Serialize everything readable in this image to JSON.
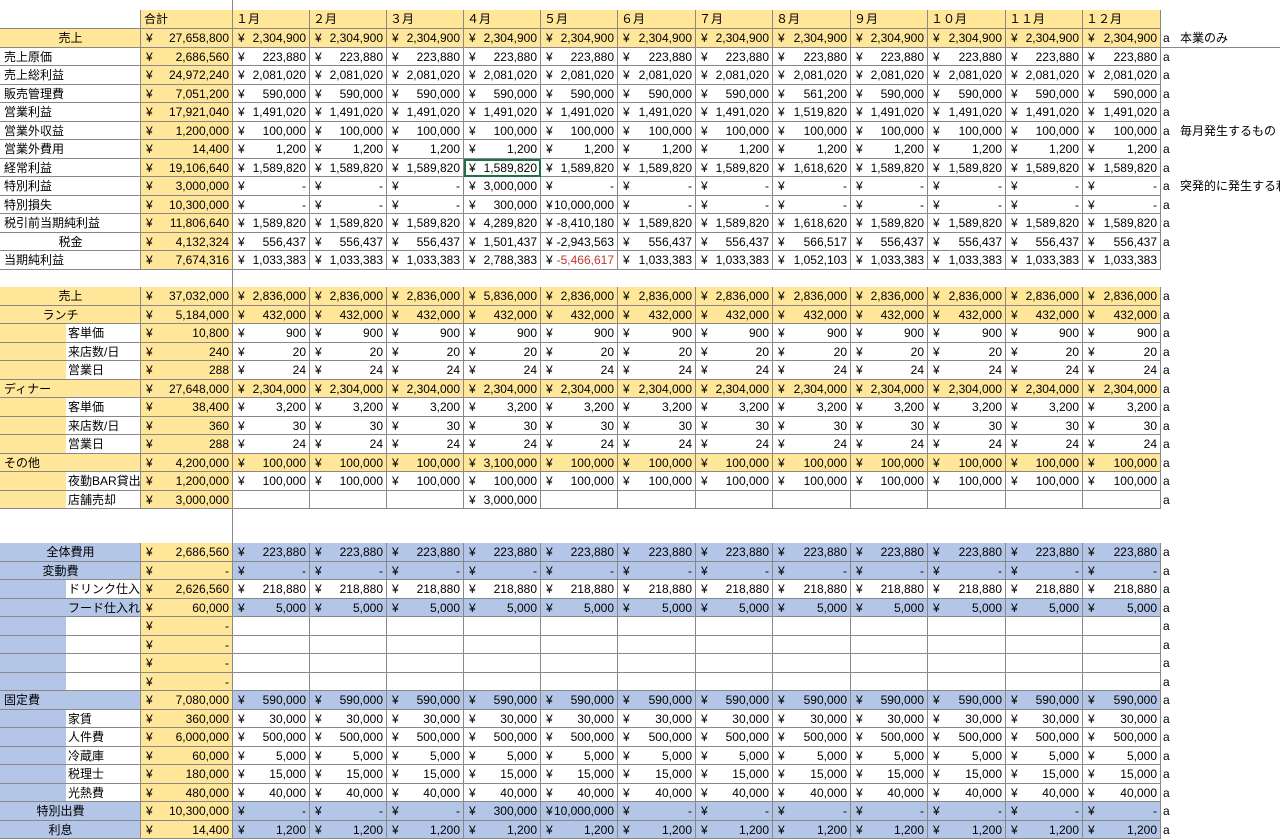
{
  "header": {
    "total_label": "合計",
    "months": [
      "１月",
      "２月",
      "３月",
      "４月",
      "５月",
      "６月",
      "７月",
      "８月",
      "９月",
      "１０月",
      "１１月",
      "１２月"
    ]
  },
  "colors": {
    "yellow": "#ffe699",
    "blue": "#b4c6e7",
    "selection": "#1e7145",
    "negative": "#c0392b"
  },
  "sections": [
    {
      "id": "pl",
      "rows": [
        {
          "label": "売上",
          "indent": "center",
          "fill": "yellow",
          "total": "27,658,800",
          "months": [
            "2,304,900",
            "2,304,900",
            "2,304,900",
            "2,304,900",
            "2,304,900",
            "2,304,900",
            "2,304,900",
            "2,304,900",
            "2,304,900",
            "2,304,900",
            "2,304,900",
            "2,304,900"
          ],
          "suffix": "a",
          "note": "本業のみ"
        },
        {
          "label": "売上原価",
          "indent": "none",
          "fill": "none",
          "total": "2,686,560",
          "months": [
            "223,880",
            "223,880",
            "223,880",
            "223,880",
            "223,880",
            "223,880",
            "223,880",
            "223,880",
            "223,880",
            "223,880",
            "223,880",
            "223,880"
          ],
          "suffix": "a"
        },
        {
          "label": "売上総利益",
          "indent": "none",
          "fill": "none",
          "total": "24,972,240",
          "months": [
            "2,081,020",
            "2,081,020",
            "2,081,020",
            "2,081,020",
            "2,081,020",
            "2,081,020",
            "2,081,020",
            "2,081,020",
            "2,081,020",
            "2,081,020",
            "2,081,020",
            "2,081,020"
          ],
          "suffix": "a"
        },
        {
          "label": "販売管理費",
          "indent": "none",
          "fill": "none",
          "total": "7,051,200",
          "months": [
            "590,000",
            "590,000",
            "590,000",
            "590,000",
            "590,000",
            "590,000",
            "590,000",
            "561,200",
            "590,000",
            "590,000",
            "590,000",
            "590,000"
          ],
          "suffix": "a",
          "flags": true
        },
        {
          "label": "営業利益",
          "indent": "none",
          "fill": "none",
          "total": "17,921,040",
          "months": [
            "1,491,020",
            "1,491,020",
            "1,491,020",
            "1,491,020",
            "1,491,020",
            "1,491,020",
            "1,491,020",
            "1,519,820",
            "1,491,020",
            "1,491,020",
            "1,491,020",
            "1,491,020"
          ],
          "suffix": "a"
        },
        {
          "label": "営業外収益",
          "indent": "none",
          "fill": "none",
          "total": "1,200,000",
          "months": [
            "100,000",
            "100,000",
            "100,000",
            "100,000",
            "100,000",
            "100,000",
            "100,000",
            "100,000",
            "100,000",
            "100,000",
            "100,000",
            "100,000"
          ],
          "suffix": "a",
          "note": "毎月発生するもの"
        },
        {
          "label": "営業外費用",
          "indent": "none",
          "fill": "none",
          "total": "14,400",
          "months": [
            "1,200",
            "1,200",
            "1,200",
            "1,200",
            "1,200",
            "1,200",
            "1,200",
            "1,200",
            "1,200",
            "1,200",
            "1,200",
            "1,200"
          ],
          "suffix": "a"
        },
        {
          "label": "経常利益",
          "indent": "none",
          "fill": "none",
          "total": "19,106,640",
          "months": [
            "1,589,820",
            "1,589,820",
            "1,589,820",
            "1,589,820",
            "1,589,820",
            "1,589,820",
            "1,589,820",
            "1,618,620",
            "1,589,820",
            "1,589,820",
            "1,589,820",
            "1,589,820"
          ],
          "suffix": "a",
          "selected": 4
        },
        {
          "label": "特別利益",
          "indent": "none",
          "fill": "none",
          "total": "3,000,000",
          "months": [
            "-",
            "-",
            "-",
            "3,000,000",
            "-",
            "-",
            "-",
            "-",
            "-",
            "-",
            "-",
            "-"
          ],
          "suffix": "a",
          "note": "突発的に発生する利"
        },
        {
          "label": "特別損失",
          "indent": "none",
          "fill": "none",
          "total": "10,300,000",
          "months": [
            "-",
            "-",
            "-",
            "300,000",
            "10,000,000",
            "-",
            "-",
            "-",
            "-",
            "-",
            "-",
            "-"
          ],
          "suffix": "a"
        },
        {
          "label": "税引前当期純利益",
          "indent": "none",
          "fill": "none",
          "total": "11,806,640",
          "months": [
            "1,589,820",
            "1,589,820",
            "1,589,820",
            "4,289,820",
            "-8,410,180",
            "1,589,820",
            "1,589,820",
            "1,618,620",
            "1,589,820",
            "1,589,820",
            "1,589,820",
            "1,589,820"
          ],
          "suffix": "a"
        },
        {
          "label": "税金",
          "indent": "center",
          "fill": "none",
          "total": "4,132,324",
          "months": [
            "556,437",
            "556,437",
            "556,437",
            "1,501,437",
            "-2,943,563",
            "556,437",
            "556,437",
            "566,517",
            "556,437",
            "556,437",
            "556,437",
            "556,437"
          ],
          "suffix": "a"
        },
        {
          "label": "当期純利益",
          "indent": "none",
          "fill": "none",
          "total": "7,674,316",
          "months": [
            "1,033,383",
            "1,033,383",
            "1,033,383",
            "2,788,383",
            "-5,466,617",
            "1,033,383",
            "1,033,383",
            "1,052,103",
            "1,033,383",
            "1,033,383",
            "1,033,383",
            "1,033,383"
          ],
          "suffix": "",
          "negative_month": 5
        }
      ]
    },
    {
      "id": "sales",
      "rows": [
        {
          "label": "売上",
          "indent": "center",
          "fill": "yellow",
          "total": "37,032,000",
          "months": [
            "2,836,000",
            "2,836,000",
            "2,836,000",
            "5,836,000",
            "2,836,000",
            "2,836,000",
            "2,836,000",
            "2,836,000",
            "2,836,000",
            "2,836,000",
            "2,836,000",
            "2,836,000"
          ],
          "suffix": "a"
        },
        {
          "label": "ランチ",
          "indent": "mid",
          "fill": "yellow",
          "total": "5,184,000",
          "months": [
            "432,000",
            "432,000",
            "432,000",
            "432,000",
            "432,000",
            "432,000",
            "432,000",
            "432,000",
            "432,000",
            "432,000",
            "432,000",
            "432,000"
          ],
          "suffix": "a"
        },
        {
          "label": "客単価",
          "indent": "sub",
          "fill": "white",
          "total": "10,800",
          "months": [
            "900",
            "900",
            "900",
            "900",
            "900",
            "900",
            "900",
            "900",
            "900",
            "900",
            "900",
            "900"
          ],
          "suffix": "a"
        },
        {
          "label": "来店数/日",
          "indent": "sub",
          "fill": "white",
          "total": "240",
          "months": [
            "20",
            "20",
            "20",
            "20",
            "20",
            "20",
            "20",
            "20",
            "20",
            "20",
            "20",
            "20"
          ],
          "suffix": "a"
        },
        {
          "label": "営業日",
          "indent": "sub",
          "fill": "white",
          "total": "288",
          "months": [
            "24",
            "24",
            "24",
            "24",
            "24",
            "24",
            "24",
            "24",
            "24",
            "24",
            "24",
            "24"
          ],
          "suffix": "a"
        },
        {
          "label": "ディナー",
          "indent": "none",
          "fill": "yellow",
          "total": "27,648,000",
          "months": [
            "2,304,000",
            "2,304,000",
            "2,304,000",
            "2,304,000",
            "2,304,000",
            "2,304,000",
            "2,304,000",
            "2,304,000",
            "2,304,000",
            "2,304,000",
            "2,304,000",
            "2,304,000"
          ],
          "suffix": "a"
        },
        {
          "label": "客単価",
          "indent": "sub",
          "fill": "white",
          "total": "38,400",
          "months": [
            "3,200",
            "3,200",
            "3,200",
            "3,200",
            "3,200",
            "3,200",
            "3,200",
            "3,200",
            "3,200",
            "3,200",
            "3,200",
            "3,200"
          ],
          "suffix": "a"
        },
        {
          "label": "来店数/日",
          "indent": "sub",
          "fill": "white",
          "total": "360",
          "months": [
            "30",
            "30",
            "30",
            "30",
            "30",
            "30",
            "30",
            "30",
            "30",
            "30",
            "30",
            "30"
          ],
          "suffix": "a"
        },
        {
          "label": "営業日",
          "indent": "sub",
          "fill": "white",
          "total": "288",
          "months": [
            "24",
            "24",
            "24",
            "24",
            "24",
            "24",
            "24",
            "24",
            "24",
            "24",
            "24",
            "24"
          ],
          "suffix": "a"
        },
        {
          "label": "その他",
          "indent": "none",
          "fill": "yellow",
          "total": "4,200,000",
          "months": [
            "100,000",
            "100,000",
            "100,000",
            "3,100,000",
            "100,000",
            "100,000",
            "100,000",
            "100,000",
            "100,000",
            "100,000",
            "100,000",
            "100,000"
          ],
          "suffix": "a"
        },
        {
          "label": "夜勤BAR貸出",
          "indent": "sub",
          "fill": "white",
          "total": "1,200,000",
          "months": [
            "100,000",
            "100,000",
            "100,000",
            "100,000",
            "100,000",
            "100,000",
            "100,000",
            "100,000",
            "100,000",
            "100,000",
            "100,000",
            "100,000"
          ],
          "suffix": "a"
        },
        {
          "label": "店舗売却",
          "indent": "sub",
          "fill": "white",
          "total": "3,000,000",
          "months": [
            "",
            "",
            "",
            "3,000,000",
            "",
            "",
            "",
            "",
            "",
            "",
            "",
            ""
          ],
          "suffix": "a",
          "noyen": true
        }
      ]
    },
    {
      "id": "costs",
      "rows": [
        {
          "label": "全体費用",
          "indent": "center",
          "fill": "blue",
          "total": "2,686,560",
          "months": [
            "223,880",
            "223,880",
            "223,880",
            "223,880",
            "223,880",
            "223,880",
            "223,880",
            "223,880",
            "223,880",
            "223,880",
            "223,880",
            "223,880"
          ],
          "suffix": "a"
        },
        {
          "label": "変動費",
          "indent": "mid",
          "fill": "blue",
          "total": "-",
          "months": [
            "-",
            "-",
            "-",
            "-",
            "-",
            "-",
            "-",
            "-",
            "-",
            "-",
            "-",
            "-"
          ],
          "suffix": "a"
        },
        {
          "label": "ドリンク仕入れ",
          "indent": "deep",
          "fill": "white",
          "total": "2,626,560",
          "months": [
            "218,880",
            "218,880",
            "218,880",
            "218,880",
            "218,880",
            "218,880",
            "218,880",
            "218,880",
            "218,880",
            "218,880",
            "218,880",
            "218,880"
          ],
          "suffix": "a"
        },
        {
          "label": "フード仕入れ",
          "indent": "deep",
          "fill": "blue",
          "total": "60,000",
          "months": [
            "5,000",
            "5,000",
            "5,000",
            "5,000",
            "5,000",
            "5,000",
            "5,000",
            "5,000",
            "5,000",
            "5,000",
            "5,000",
            "5,000"
          ],
          "suffix": "a"
        },
        {
          "label": "",
          "indent": "deep",
          "fill": "white",
          "total": "-",
          "months": [
            "",
            "",
            "",
            "",
            "",
            "",
            "",
            "",
            "",
            "",
            "",
            ""
          ],
          "suffix": "a",
          "noyen": true
        },
        {
          "label": "",
          "indent": "deep",
          "fill": "white",
          "total": "-",
          "months": [
            "",
            "",
            "",
            "",
            "",
            "",
            "",
            "",
            "",
            "",
            "",
            ""
          ],
          "suffix": "a",
          "noyen": true
        },
        {
          "label": "",
          "indent": "deep",
          "fill": "white",
          "total": "-",
          "months": [
            "",
            "",
            "",
            "",
            "",
            "",
            "",
            "",
            "",
            "",
            "",
            ""
          ],
          "suffix": "a",
          "noyen": true
        },
        {
          "label": "",
          "indent": "deep",
          "fill": "white",
          "total": "-",
          "months": [
            "",
            "",
            "",
            "",
            "",
            "",
            "",
            "",
            "",
            "",
            "",
            ""
          ],
          "suffix": "a",
          "noyen": true
        },
        {
          "label": "固定費",
          "indent": "none",
          "fill": "blue",
          "total": "7,080,000",
          "months": [
            "590,000",
            "590,000",
            "590,000",
            "590,000",
            "590,000",
            "590,000",
            "590,000",
            "590,000",
            "590,000",
            "590,000",
            "590,000",
            "590,000"
          ],
          "suffix": "a"
        },
        {
          "label": "家賃",
          "indent": "sub",
          "fill": "white",
          "total": "360,000",
          "months": [
            "30,000",
            "30,000",
            "30,000",
            "30,000",
            "30,000",
            "30,000",
            "30,000",
            "30,000",
            "30,000",
            "30,000",
            "30,000",
            "30,000"
          ],
          "suffix": "a"
        },
        {
          "label": "人件費",
          "indent": "sub",
          "fill": "white",
          "total": "6,000,000",
          "months": [
            "500,000",
            "500,000",
            "500,000",
            "500,000",
            "500,000",
            "500,000",
            "500,000",
            "500,000",
            "500,000",
            "500,000",
            "500,000",
            "500,000"
          ],
          "suffix": "a"
        },
        {
          "label": "冷蔵庫",
          "indent": "sub",
          "fill": "white",
          "total": "60,000",
          "months": [
            "5,000",
            "5,000",
            "5,000",
            "5,000",
            "5,000",
            "5,000",
            "5,000",
            "5,000",
            "5,000",
            "5,000",
            "5,000",
            "5,000"
          ],
          "suffix": "a"
        },
        {
          "label": "税理士",
          "indent": "sub",
          "fill": "white",
          "total": "180,000",
          "months": [
            "15,000",
            "15,000",
            "15,000",
            "15,000",
            "15,000",
            "15,000",
            "15,000",
            "15,000",
            "15,000",
            "15,000",
            "15,000",
            "15,000"
          ],
          "suffix": "a"
        },
        {
          "label": "光熱費",
          "indent": "sub",
          "fill": "white",
          "total": "480,000",
          "months": [
            "40,000",
            "40,000",
            "40,000",
            "40,000",
            "40,000",
            "40,000",
            "40,000",
            "40,000",
            "40,000",
            "40,000",
            "40,000",
            "40,000"
          ],
          "suffix": "a"
        },
        {
          "label": "特別出費",
          "indent": "mid",
          "fill": "blue",
          "total": "10,300,000",
          "months": [
            "-",
            "-",
            "-",
            "300,000",
            "10,000,000",
            "-",
            "-",
            "-",
            "-",
            "-",
            "-",
            "-"
          ],
          "suffix": "a"
        },
        {
          "label": "利息",
          "indent": "mid",
          "fill": "blue",
          "total": "14,400",
          "months": [
            "1,200",
            "1,200",
            "1,200",
            "1,200",
            "1,200",
            "1,200",
            "1,200",
            "1,200",
            "1,200",
            "1,200",
            "1,200",
            "1,200"
          ],
          "suffix": "a"
        }
      ]
    }
  ]
}
